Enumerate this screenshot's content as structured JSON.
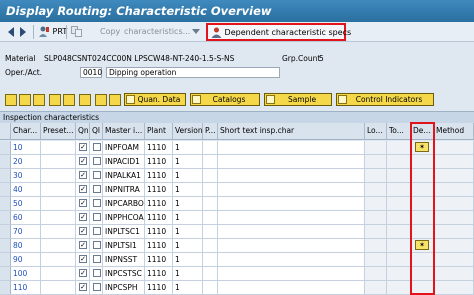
{
  "window": {
    "title": "Display Routing: Characteristic Overview"
  },
  "toolbar": {
    "prt_label": "PRT",
    "copy_label": "Copy",
    "characteristics_label": "characteristics...",
    "dependent_specs_label": "Dependent characteristic specs"
  },
  "header": {
    "material_label": "Material",
    "material_value": "SLP048CSNT024CC00N LPSCW48-NT-240-1.5-S-NS",
    "grp_count_label": "Grp.Count",
    "grp_count_value": "5",
    "oper_label": "Oper./Act.",
    "oper_value": "0010",
    "oper_desc": "Dipping operation"
  },
  "tabs": [
    {
      "label": "Quan. Data"
    },
    {
      "label": "Catalogs"
    },
    {
      "label": "Sample"
    },
    {
      "label": "Control Indicators"
    }
  ],
  "grid": {
    "title": "Inspection characteristics",
    "columns": [
      "Char...",
      "Preset...",
      "Qn",
      "Ql",
      "Master i...",
      "Plant",
      "Version",
      "P...",
      "Short text insp.char",
      "Lo...",
      "To...",
      "De...",
      "Method"
    ],
    "rows": [
      {
        "char": "10",
        "qn": true,
        "master": "INPFOAM",
        "plant": "1110",
        "version": "1",
        "dep": true
      },
      {
        "char": "20",
        "qn": true,
        "master": "INPACID1",
        "plant": "1110",
        "version": "1",
        "dep": false
      },
      {
        "char": "30",
        "qn": true,
        "master": "INPALKA1",
        "plant": "1110",
        "version": "1",
        "dep": false
      },
      {
        "char": "40",
        "qn": true,
        "master": "INPNITRA",
        "plant": "1110",
        "version": "1",
        "dep": false
      },
      {
        "char": "50",
        "qn": true,
        "master": "INPCARBO",
        "plant": "1110",
        "version": "1",
        "dep": false
      },
      {
        "char": "60",
        "qn": true,
        "master": "INPPHCOA",
        "plant": "1110",
        "version": "1",
        "dep": false
      },
      {
        "char": "70",
        "qn": true,
        "master": "INPLTSC1",
        "plant": "1110",
        "version": "1",
        "dep": false
      },
      {
        "char": "80",
        "qn": true,
        "master": "INPLTSI1",
        "plant": "1110",
        "version": "1",
        "dep": true
      },
      {
        "char": "90",
        "qn": true,
        "master": "INPNSST",
        "plant": "1110",
        "version": "1",
        "dep": false
      },
      {
        "char": "100",
        "qn": true,
        "master": "INPCSTSC",
        "plant": "1110",
        "version": "1",
        "dep": false
      },
      {
        "char": "110",
        "qn": true,
        "master": "INPCSPH",
        "plant": "1110",
        "version": "1",
        "dep": false
      }
    ]
  },
  "colors": {
    "highlight": "#e0141a",
    "title_bar": "#2f7db0",
    "button_yellow": "#f5d84a"
  },
  "icons": [
    "back-arrow-icon",
    "forward-arrow-icon",
    "prt-icon",
    "copy-icon",
    "person-icon",
    "table-settings-icon",
    "dependency-icon"
  ]
}
